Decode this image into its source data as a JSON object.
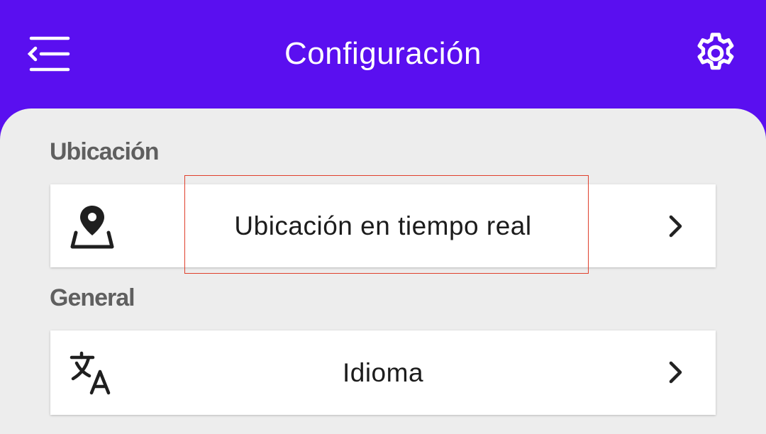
{
  "header": {
    "title": "Configuración",
    "menu_icon": "menu-back-icon",
    "settings_icon": "gear-icon",
    "background_color": "#5A0FF0"
  },
  "sections": [
    {
      "heading": "Ubicación",
      "items": [
        {
          "label": "Ubicación en tiempo real",
          "icon": "location-pin-icon",
          "trailing_icon": "chevron-right-icon"
        }
      ]
    },
    {
      "heading": "General",
      "items": [
        {
          "label": "Idioma",
          "icon": "translate-icon",
          "trailing_icon": "chevron-right-icon"
        }
      ]
    }
  ],
  "colors": {
    "accent": "#5A0FF0",
    "content_background": "#EDEDED",
    "highlight": "#E0402C"
  }
}
